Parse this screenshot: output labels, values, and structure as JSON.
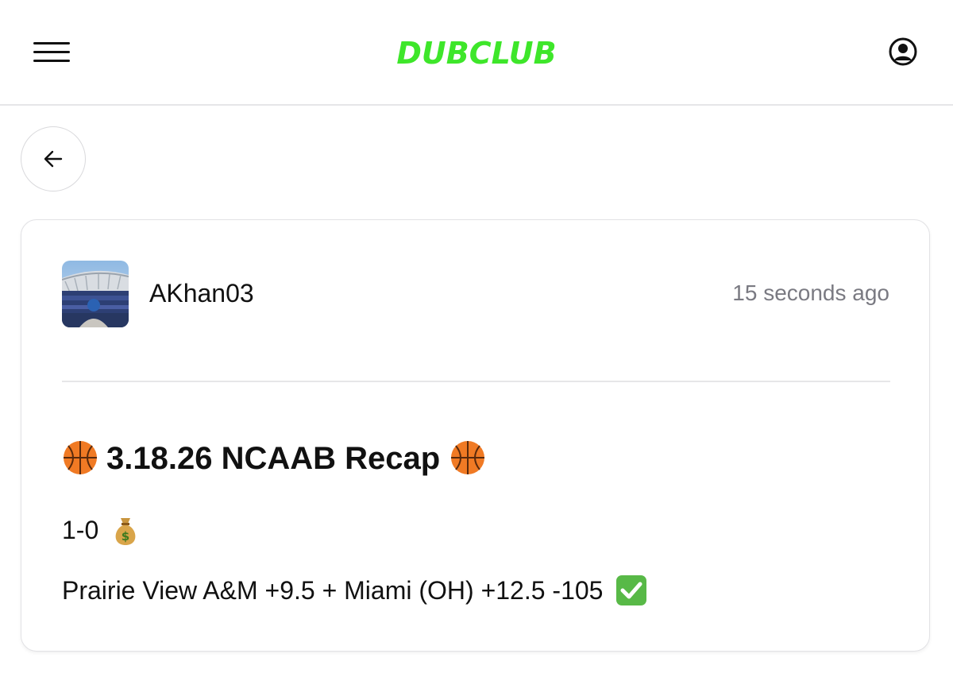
{
  "header": {
    "menu_icon": "hamburger-menu-icon",
    "logo_text": "DUBCLUB",
    "logo_color": "#3ee62a",
    "account_icon": "user-circle-icon"
  },
  "nav": {
    "back_icon": "arrow-left-icon"
  },
  "post": {
    "author": "AKhan03",
    "timestamp": "15 seconds ago",
    "avatar_icon": "stadium-photo-avatar",
    "title": "3.18.26 NCAAB Recap",
    "title_emoji": "basketball-icon",
    "record": "1-0",
    "record_emoji": "money-bag-icon",
    "pick": "Prairie View A&M +9.5 + Miami (OH) +12.5 -105",
    "pick_emoji": "check-mark-button-icon"
  }
}
